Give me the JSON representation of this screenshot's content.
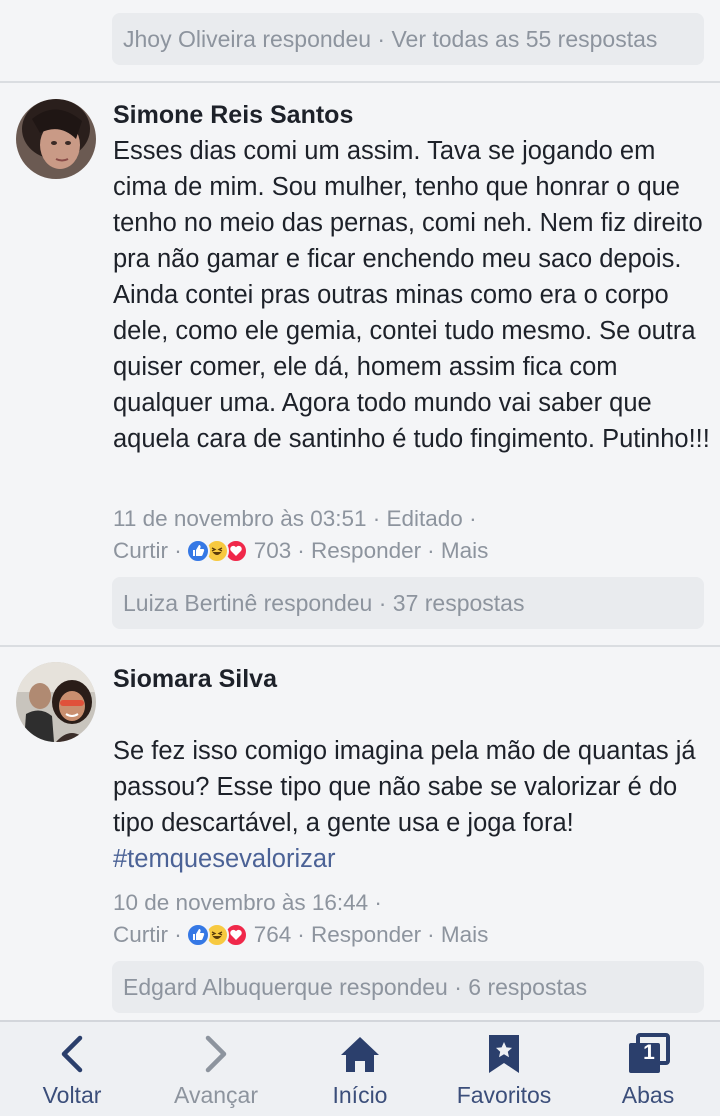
{
  "top_reply": {
    "text": "Jhoy Oliveira respondeu · Ver todas as 55 respostas"
  },
  "comments": [
    {
      "author": "Simone Reis Santos",
      "text": "Esses dias comi um assim. Tava se jogando em cima de mim. Sou mulher, tenho que honrar o que tenho no meio das pernas, comi neh. Nem fiz direito pra não gamar e ficar enchendo meu saco depois. Ainda contei pras outras minas como era o corpo dele, como ele gemia, contei tudo mesmo. Se outra quiser comer, ele dá, homem assim fica com qualquer uma. Agora todo mundo vai saber que aquela cara de santinho é tudo fingimento. Putinho!!!",
      "hashtag": "",
      "meta": "11 de novembro às 03:51 · Editado ·",
      "like_label": "Curtir ·",
      "reaction_count": "703",
      "reply_label": "· Responder",
      "more_label": "· Mais",
      "reply_summary": "Luiza Bertinê respondeu · 37 respostas"
    },
    {
      "author": "Siomara Silva",
      "text": "Se fez isso comigo imagina pela mão de quantas já passou? Esse tipo que não sabe se valorizar é do tipo descartável, a gente usa e joga fora!",
      "hashtag": "#temquesevalorizar",
      "meta": "10 de novembro às 16:44 ·",
      "like_label": "Curtir ·",
      "reaction_count": "764",
      "reply_label": "· Responder",
      "more_label": "· Mais",
      "reply_summary": "Edgard Albuquerque respondeu · 6 respostas"
    }
  ],
  "nav": {
    "back": "Voltar",
    "forward": "Avançar",
    "home": "Início",
    "favorites": "Favoritos",
    "tabs": "Abas",
    "tabs_count": "1"
  },
  "colors": {
    "like": "#3578e5",
    "haha": "#f7c940",
    "love": "#f0284a",
    "nav": "#2b3f6c",
    "muted": "#8d949e"
  }
}
